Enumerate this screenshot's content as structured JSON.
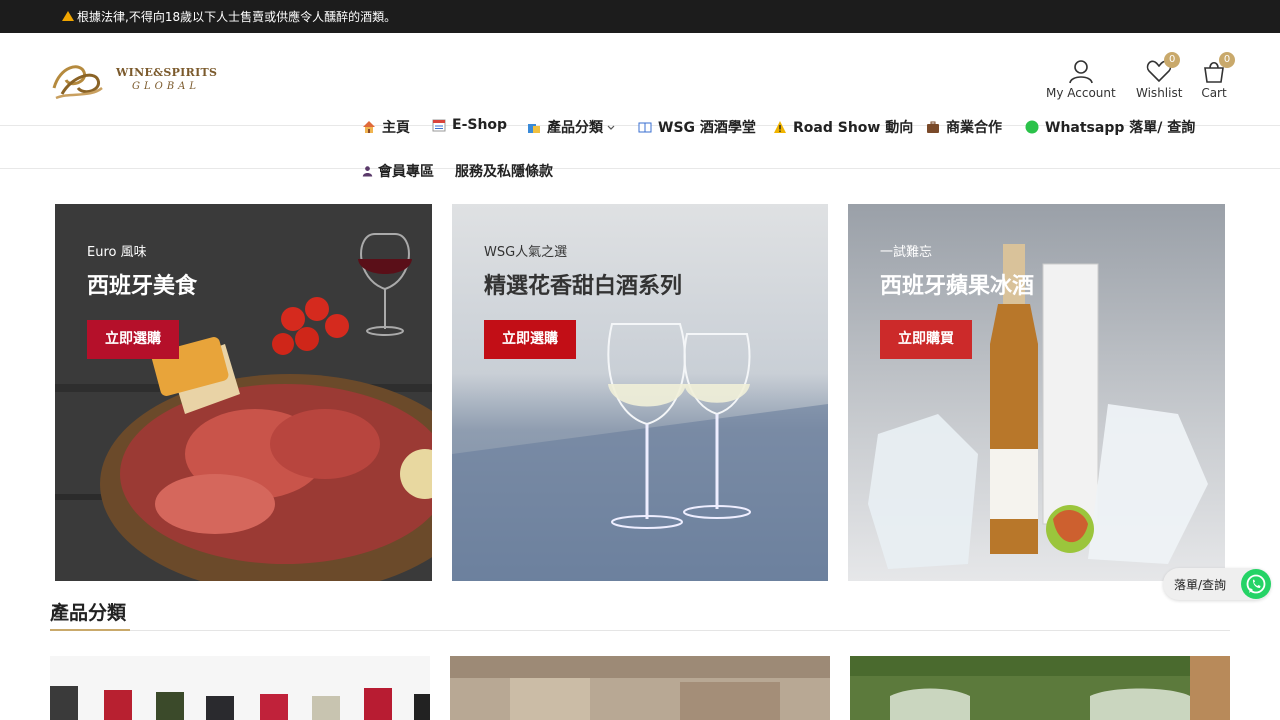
{
  "topbar": {
    "notice": "根據法律,不得向18歲以下人士售賣或供應令人醺醉的酒類。"
  },
  "logo": {
    "line1": "WINE&SPIRITS",
    "line2": "GLOBAL"
  },
  "header_icons": {
    "account_label": "My Account",
    "wishlist_label": "Wishlist",
    "wishlist_count": "0",
    "cart_label": "Cart",
    "cart_count": "0"
  },
  "nav": {
    "items": [
      {
        "label": "主頁",
        "icon": "home-icon"
      },
      {
        "label": "E-Shop",
        "icon": "calendar-icon"
      },
      {
        "label": "產品分類",
        "icon": "shopping-bag-icon"
      },
      {
        "label": "WSG 酒酒學堂",
        "icon": "book-icon"
      },
      {
        "label": "Road Show 動向",
        "icon": "warning-icon"
      },
      {
        "label": "商業合作",
        "icon": "briefcase-icon"
      },
      {
        "label": "Whatsapp 落單/ 查詢",
        "icon": "green-circle-icon"
      },
      {
        "label": "會員專區",
        "icon": "person-icon"
      },
      {
        "label": "服務及私隱條款",
        "icon": ""
      }
    ]
  },
  "banners": [
    {
      "subtitle": "Euro 風味",
      "title": "西班牙美食",
      "button": "立即選購",
      "button_color": "#b5102a"
    },
    {
      "subtitle": "WSG人氣之選",
      "title": "精選花香甜白酒系列",
      "button": "立即選購",
      "button_color": "#c20e16"
    },
    {
      "subtitle": "一試難忘",
      "title": "西班牙蘋果冰酒",
      "button": "立即購買",
      "button_color": "#cc2a2a"
    }
  ],
  "section": {
    "title": "產品分類"
  },
  "whatsapp": {
    "label": "落單/查詢",
    "color": "#25d366"
  },
  "colors": {
    "accent_gold": "#c9a96b",
    "topbar_bg": "#1c1c1c"
  }
}
